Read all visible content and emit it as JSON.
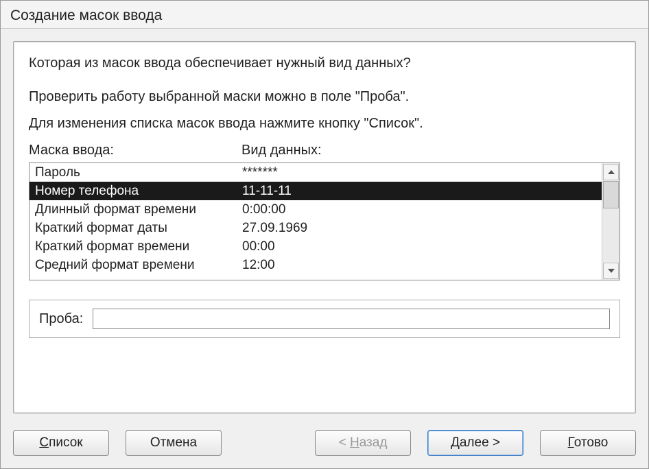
{
  "title": "Создание масок ввода",
  "prompt": "Которая из масок ввода обеспечивает нужный вид данных?",
  "instruction1": "Проверить работу выбранной маски можно в поле \"Проба\".",
  "instruction2": "Для изменения списка масок ввода нажмите кнопку \"Список\".",
  "columns": {
    "mask": "Маска ввода:",
    "view": "Вид данных:"
  },
  "rows": [
    {
      "name": "Пароль",
      "sample": "*******",
      "selected": false
    },
    {
      "name": "Номер телефона",
      "sample": "11-11-11",
      "selected": true
    },
    {
      "name": "Длинный формат времени",
      "sample": "0:00:00",
      "selected": false
    },
    {
      "name": "Краткий формат даты",
      "sample": "27.09.1969",
      "selected": false
    },
    {
      "name": "Краткий формат времени",
      "sample": "00:00",
      "selected": false
    },
    {
      "name": "Средний формат времени",
      "sample": "12:00",
      "selected": false
    }
  ],
  "try": {
    "label": "Проба:",
    "value": ""
  },
  "buttons": {
    "list": "Список",
    "cancel": "Отмена",
    "back": "< Назад",
    "next": "Далее >",
    "finish": "Готово"
  }
}
